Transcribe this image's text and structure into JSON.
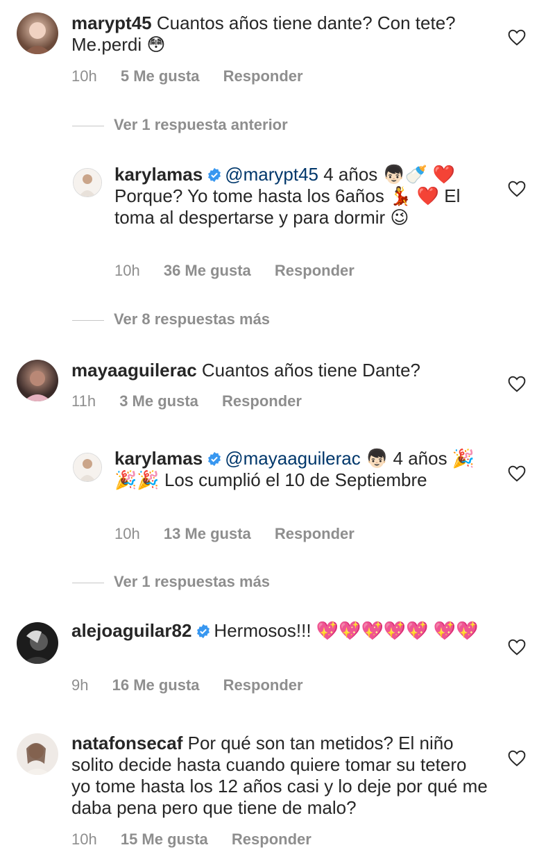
{
  "comments": [
    {
      "username": "marypt45",
      "text": "Cuantos años tiene dante? Con tete? Me.perdi 😳",
      "time": "10h",
      "likes": "5 Me gusta",
      "reply": "Responder"
    },
    {
      "view_more": "Ver 1 respuesta anterior"
    },
    {
      "username": "karylamas",
      "mention": "@marypt45",
      "text": " 4 años 👦🏻🍼 ❤️ Porque? Yo tome hasta los 6años 💃 ❤️ El toma al despertarse y para dormir 😉",
      "time": "10h",
      "likes": "36 Me gusta",
      "reply": "Responder"
    },
    {
      "view_more": "Ver 8 respuestas más"
    },
    {
      "username": "mayaaguilerac",
      "text": "Cuantos años tiene Dante?",
      "time": "11h",
      "likes": "3 Me gusta",
      "reply": "Responder"
    },
    {
      "username": "karylamas",
      "mention": "@mayaaguilerac",
      "text": " 👦🏻 4 años 🎉🎉🎉 Los cumplió el 10 de Septiembre",
      "time": "10h",
      "likes": "13 Me gusta",
      "reply": "Responder"
    },
    {
      "view_more": "Ver 1 respuestas más"
    },
    {
      "username": "alejoaguilar82",
      "text": "Hermosos!!! 💖💖💖💖💖 💖💖",
      "time": "9h",
      "likes": "16 Me gusta",
      "reply": "Responder"
    },
    {
      "username": "natafonsecaf",
      "text": "Por qué son tan metidos? El niño solito decide hasta cuando quiere tomar su tetero yo tome hasta los 12 años casi y lo deje por qué me daba pena pero que tiene de malo?",
      "time": "10h",
      "likes": "15 Me gusta",
      "reply": "Responder"
    }
  ],
  "colors": {
    "text": "#262626",
    "meta": "#8e8e8e",
    "verified": "#3897f0",
    "mention": "#00376b"
  },
  "icons": [
    "heart-icon",
    "verified-badge-icon"
  ]
}
